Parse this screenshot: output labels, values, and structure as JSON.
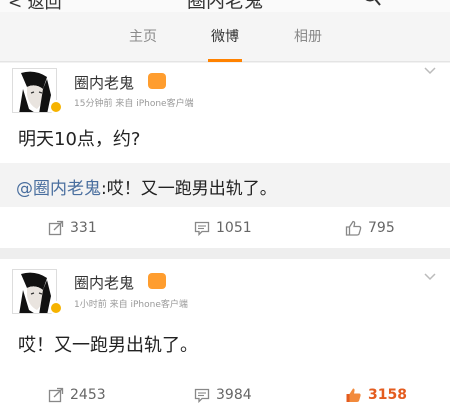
{
  "navbar": {
    "back_label": "< 返回",
    "title": "圈内老鬼"
  },
  "tabs": [
    {
      "label": "主页"
    },
    {
      "label": "微博"
    },
    {
      "label": "相册"
    }
  ],
  "posts": [
    {
      "username": "圈内老鬼",
      "time": "15分钟前",
      "source": "来自 iPhone客户端",
      "text": "明天10点，约?",
      "repost": {
        "mention": "@圈内老鬼",
        "text": ":哎！又一跑男出轨了。"
      },
      "actions": {
        "repost_count": "331",
        "comment_count": "1051",
        "like_count": "795"
      },
      "liked": false
    },
    {
      "username": "圈内老鬼",
      "time": "1小时前",
      "source": "来自 iPhone客户端",
      "text": "哎！又一跑男出轨了。",
      "actions": {
        "repost_count": "2453",
        "comment_count": "3984",
        "like_count": "3158"
      },
      "liked": true
    }
  ],
  "colors": {
    "accent": "#ff8200",
    "mention": "#4a6f9f",
    "liked": "#e45c1f"
  }
}
